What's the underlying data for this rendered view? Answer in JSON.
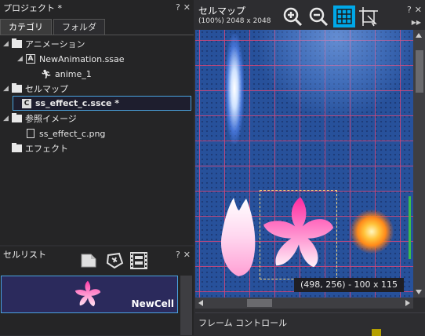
{
  "project": {
    "title": "プロジェクト *",
    "tabs": [
      "カテゴリ",
      "フォルダ"
    ],
    "tree": {
      "animation_folder": "アニメーション",
      "animation_file": "NewAnimation.ssae",
      "anime": "anime_1",
      "cellmap_folder": "セルマップ",
      "cellmap_file": "ss_effect_c.ssce *",
      "ref_folder": "参照イメージ",
      "ref_file": "ss_effect_c.png",
      "effect_folder": "エフェクト"
    }
  },
  "celllist": {
    "title": "セルリスト",
    "cell_name": "NewCell"
  },
  "cellmap": {
    "title": "セルマップ",
    "info": "(100%) 2048 x 2048",
    "selection_info": "(498, 256) - 100 x 115"
  },
  "frame": {
    "title": "フレーム コントロール"
  },
  "common": {
    "help": "?",
    "close": "✕",
    "pin": "▶▶"
  },
  "colors": {
    "accent": "#4aa3df",
    "grid_button_active": "#00a8e8",
    "viewport_bg": "#27519b"
  }
}
